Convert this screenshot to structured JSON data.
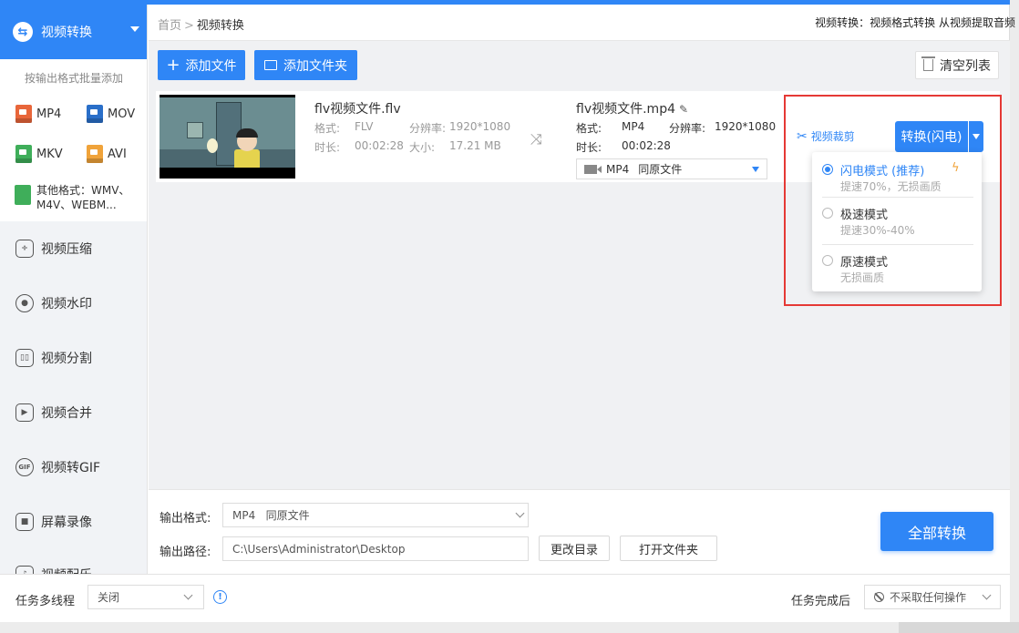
{
  "sidebar": {
    "active": {
      "label": "视频转换"
    },
    "batch_hint": "按输出格式批量添加",
    "formats": [
      {
        "label": "MP4",
        "color": "#e8663a"
      },
      {
        "label": "MOV",
        "color": "#2a6fc9"
      },
      {
        "label": "MKV",
        "color": "#3fae5a"
      },
      {
        "label": "AVI",
        "color": "#f0a33a"
      }
    ],
    "other_formats": {
      "line1": "其他格式：WMV、",
      "line2": "M4V、WEBM..."
    },
    "items": [
      {
        "label": "视频压缩",
        "icon": "compress-icon"
      },
      {
        "label": "视频水印",
        "icon": "watermark-icon"
      },
      {
        "label": "视频分割",
        "icon": "split-icon"
      },
      {
        "label": "视频合并",
        "icon": "merge-icon"
      },
      {
        "label": "视频转GIF",
        "icon": "gif-icon",
        "icon_text": "GIF"
      },
      {
        "label": "屏幕录像",
        "icon": "screen-record-icon"
      },
      {
        "label": "视频配乐",
        "icon": "music-icon"
      }
    ]
  },
  "header": {
    "breadcrumb_home": "首页",
    "breadcrumb_sep": ">",
    "breadcrumb_current": "视频转换",
    "note": "视频转换：视频格式转换 从视频提取音频"
  },
  "toolbar": {
    "add_file": "添加文件",
    "add_folder": "添加文件夹",
    "clear_list": "清空列表"
  },
  "file": {
    "source": {
      "name": "flv视频文件.flv",
      "format_label": "格式:",
      "format": "FLV",
      "resolution_label": "分辨率:",
      "resolution": "1920*1080",
      "duration_label": "时长:",
      "duration": "00:02:28",
      "size_label": "大小:",
      "size": "17.21 MB"
    },
    "output": {
      "name": "flv视频文件.mp4",
      "format_label": "格式:",
      "format": "MP4",
      "resolution_label": "分辨率:",
      "resolution": "1920*1080",
      "duration_label": "时长:",
      "duration": "00:02:28",
      "format_select": "MP4",
      "format_select_sub": "同原文件"
    },
    "crop_label": "视频裁剪",
    "convert_button": "转换(闪电)"
  },
  "mode_menu": {
    "options": [
      {
        "title": "闪电模式 (推荐)",
        "desc": "提速70%，无损画质",
        "selected": true
      },
      {
        "title": "极速模式",
        "desc": "提速30%-40%",
        "selected": false
      },
      {
        "title": "原速模式",
        "desc": "无损画质",
        "selected": false
      }
    ]
  },
  "output_panel": {
    "format_label": "输出格式:",
    "format_value": "MP4   同原文件",
    "path_label": "输出路径:",
    "path_value": "C:\\Users\\Administrator\\Desktop",
    "change_dir": "更改目录",
    "open_folder": "打开文件夹",
    "convert_all": "全部转换"
  },
  "status_bar": {
    "multithread_label": "任务多线程",
    "multithread_value": "关闭",
    "after_label": "任务完成后",
    "after_value": "不采取任何操作"
  },
  "colors": {
    "accent": "#2f86f6",
    "highlight": "#e53935",
    "bolt": "#f0a33a"
  }
}
